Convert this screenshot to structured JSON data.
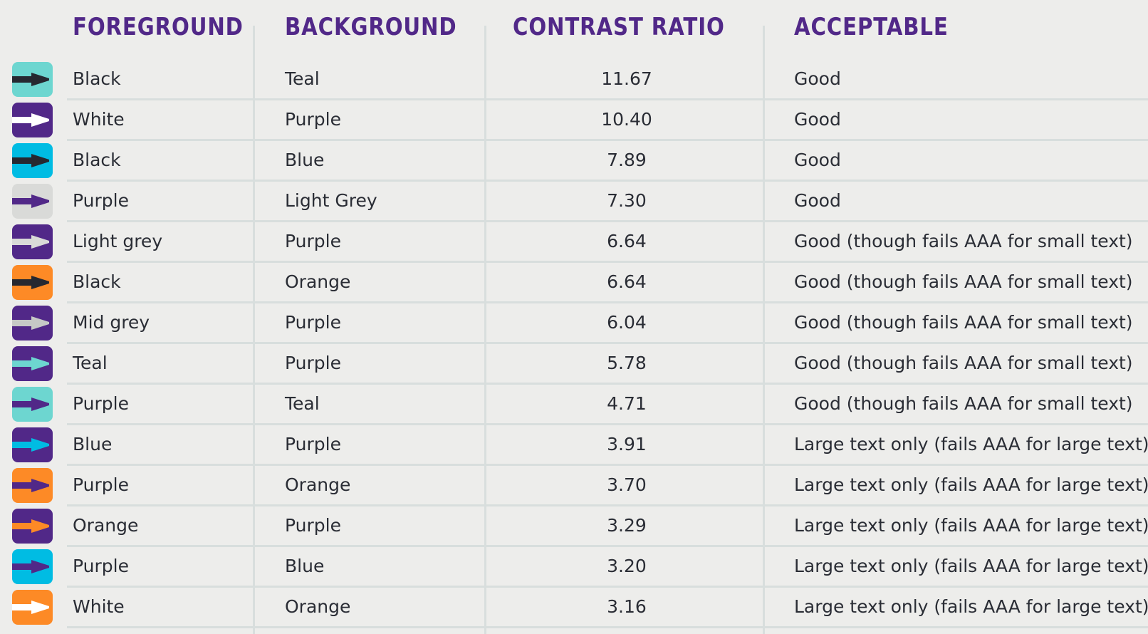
{
  "headers": {
    "foreground": "FOREGROUND",
    "background": "BACKGROUND",
    "contrast_ratio": "CONTRAST RATIO",
    "acceptable": "ACCEPTABLE"
  },
  "colors": {
    "Black": "#262830",
    "White": "#ffffff",
    "Purple": "#512888",
    "Teal": "#6dd6d0",
    "Blue": "#00bce3",
    "Light Grey": "#d9dad8",
    "Light grey": "#d9dad8",
    "Mid grey": "#c6c9c6",
    "Orange": "#fd8a26",
    "accent_header": "#512888"
  },
  "rows": [
    {
      "foreground": "Black",
      "background": "Teal",
      "ratio": "11.67",
      "acceptable": "Good"
    },
    {
      "foreground": "White",
      "background": "Purple",
      "ratio": "10.40",
      "acceptable": "Good"
    },
    {
      "foreground": "Black",
      "background": "Blue",
      "ratio": "7.89",
      "acceptable": "Good"
    },
    {
      "foreground": "Purple",
      "background": "Light Grey",
      "ratio": "7.30",
      "acceptable": "Good"
    },
    {
      "foreground": "Light grey",
      "background": "Purple",
      "ratio": "6.64",
      "acceptable": "Good (though fails AAA for small text)"
    },
    {
      "foreground": "Black",
      "background": "Orange",
      "ratio": "6.64",
      "acceptable": "Good (though fails AAA for small text)"
    },
    {
      "foreground": "Mid grey",
      "background": "Purple",
      "ratio": "6.04",
      "acceptable": "Good (though fails AAA for small text)"
    },
    {
      "foreground": "Teal",
      "background": "Purple",
      "ratio": "5.78",
      "acceptable": "Good (though fails AAA for small text)"
    },
    {
      "foreground": "Purple",
      "background": "Teal",
      "ratio": "4.71",
      "acceptable": "Good (though fails AAA for small text)"
    },
    {
      "foreground": "Blue",
      "background": "Purple",
      "ratio": "3.91",
      "acceptable": "Large text only (fails AAA for large text)"
    },
    {
      "foreground": "Purple",
      "background": "Orange",
      "ratio": "3.70",
      "acceptable": "Large text only (fails AAA for large text)"
    },
    {
      "foreground": "Orange",
      "background": "Purple",
      "ratio": "3.29",
      "acceptable": "Large text only (fails AAA for large text)"
    },
    {
      "foreground": "Purple",
      "background": "Blue",
      "ratio": "3.20",
      "acceptable": "Large text only (fails AAA for large text)"
    },
    {
      "foreground": "White",
      "background": "Orange",
      "ratio": "3.16",
      "acceptable": "Large text only (fails AAA for large text)"
    }
  ]
}
